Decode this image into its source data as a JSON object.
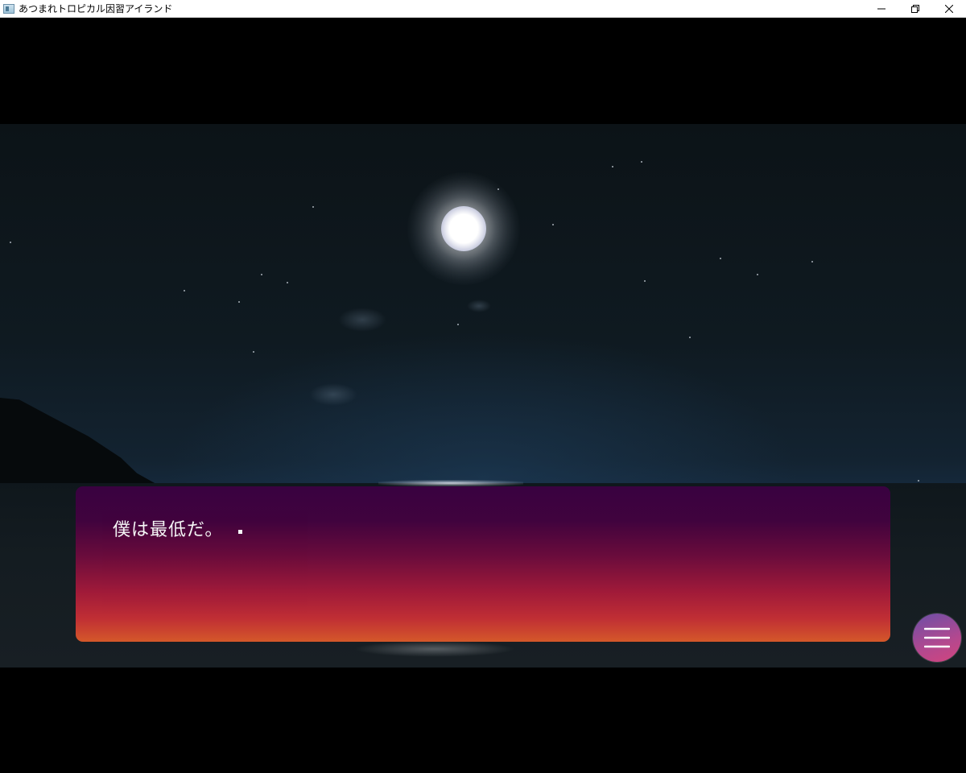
{
  "window": {
    "title": "あつまれトロピカル因習アイランド",
    "controls": {
      "minimize_icon": "minimize-icon",
      "maximize_icon": "restore-icon",
      "close_icon": "close-icon"
    }
  },
  "dialogue": {
    "text": "僕は最低だ。"
  },
  "menu": {
    "icon": "hamburger-menu-icon"
  },
  "colors": {
    "message_top": "#3b0142",
    "message_bottom": "#dc5a2a",
    "menu_button_start": "#6b4fa8",
    "menu_button_end": "#d2457e",
    "letterbox": "#000000"
  }
}
